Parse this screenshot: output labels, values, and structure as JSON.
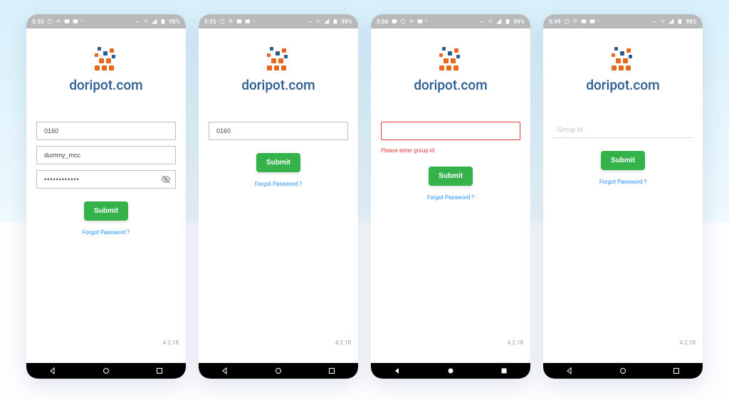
{
  "brand": "doripot.com",
  "version": "4.2.18",
  "submit_label": "Submit",
  "forgot_label": "Forgot Password ?",
  "battery_label": "98%",
  "screens": [
    {
      "time": "5:35",
      "fields": [
        {
          "type": "text",
          "value": "0160"
        },
        {
          "type": "text",
          "value": "dummy_mcc"
        },
        {
          "type": "password",
          "value": "••••••••••••",
          "has_eye": true
        }
      ]
    },
    {
      "time": "5:55",
      "fields": [
        {
          "type": "text",
          "value": "0160"
        }
      ]
    },
    {
      "time": "5:56",
      "fields": [
        {
          "type": "text",
          "value": "",
          "error": true
        }
      ],
      "error_text": "Please enter group id"
    },
    {
      "time": "5:49",
      "fields": [
        {
          "type": "underline",
          "placeholder": "Group Id",
          "value": ""
        }
      ]
    }
  ]
}
